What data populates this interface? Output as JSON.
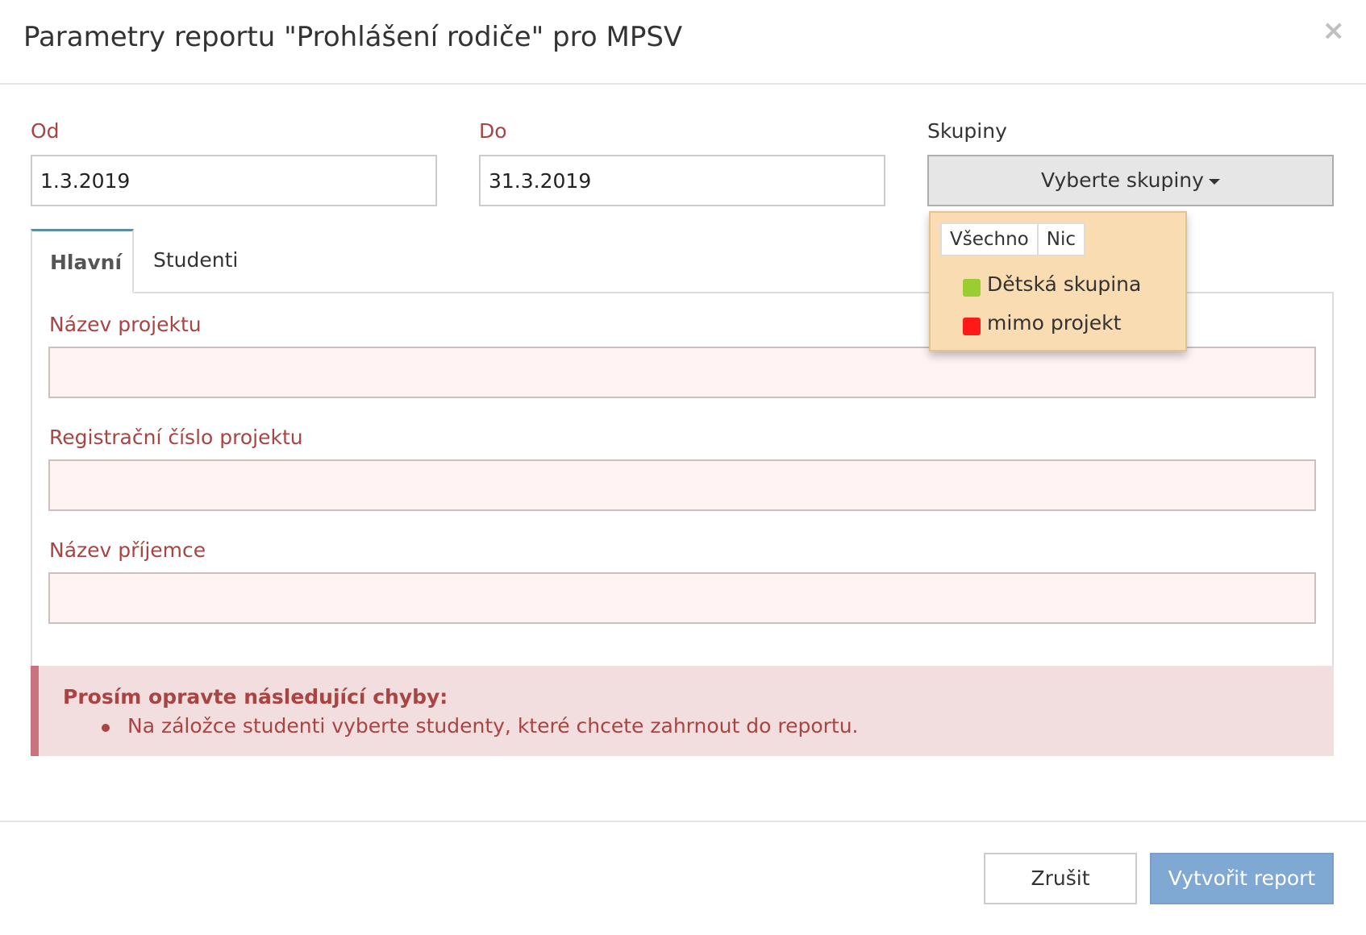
{
  "dialog": {
    "title": "Parametry reportu \"Prohlášení rodiče\" pro MPSV",
    "close_label": "×"
  },
  "fields": {
    "from": {
      "label": "Od",
      "value": "1.3.2019"
    },
    "to": {
      "label": "Do",
      "value": "31.3.2019"
    },
    "groups": {
      "label": "Skupiny",
      "button_label": "Vyberte skupiny"
    }
  },
  "groups_dropdown": {
    "all_label": "Všechno",
    "none_label": "Nic",
    "options": [
      {
        "label": "Dětská skupina",
        "color": "#9acd32"
      },
      {
        "label": "mimo projekt",
        "color": "#ff1a1a"
      }
    ]
  },
  "tabs": [
    {
      "label": "Hlavní",
      "active": true
    },
    {
      "label": "Studenti",
      "active": false
    }
  ],
  "main_tab": {
    "project_name": {
      "label": "Název projektu",
      "value": ""
    },
    "registration_number": {
      "label": "Registrační číslo projektu",
      "value": ""
    },
    "recipient_name": {
      "label": "Název příjemce",
      "value": ""
    }
  },
  "errors": {
    "title": "Prosím opravte následující chyby:",
    "items": [
      "Na záložce studenti vyberte studenty, které chcete zahrnout do reportu."
    ]
  },
  "footer": {
    "cancel_label": "Zrušit",
    "submit_label": "Vytvořit report"
  },
  "colors": {
    "error_text": "#a94442",
    "primary_button": "#7fa9d2",
    "dropdown_bg": "#f9dcb1"
  }
}
